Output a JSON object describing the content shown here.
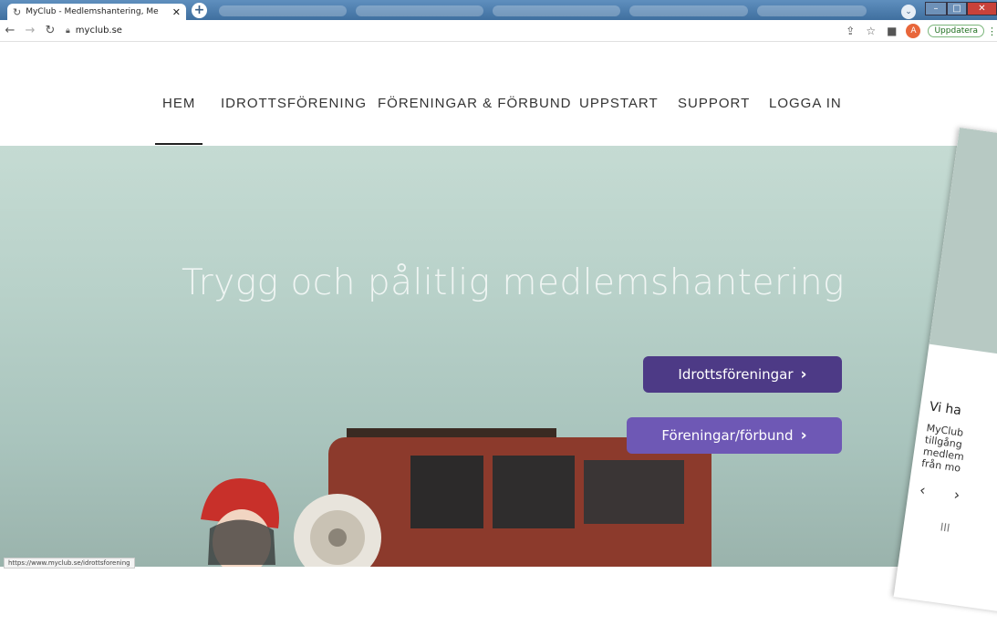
{
  "browser": {
    "tab_title": "MyClub - Medlemshantering, Me",
    "url": "myclub.se",
    "update_label": "Uppdatera",
    "profile_initial": "A",
    "status_url": "https://www.myclub.se/idrottsforening"
  },
  "nav": {
    "items": [
      {
        "label": "HEM"
      },
      {
        "label": "IDROTTSFÖRENING"
      },
      {
        "label": "FÖRENINGAR & FÖRBUND"
      },
      {
        "label": "UPPSTART"
      },
      {
        "label": "SUPPORT"
      },
      {
        "label": "LOGGA IN"
      }
    ]
  },
  "hero": {
    "title": "Trygg och pålitlig medlemshantering",
    "cta_primary": "Idrottsföreningar",
    "cta_secondary": "Föreningar/förbund"
  },
  "overlay": {
    "heading": "Vi ha",
    "text_lines": [
      "MyClub",
      "tillgång",
      "medlem",
      "från mo"
    ],
    "pager": "III"
  },
  "colors": {
    "cta_primary": "#4d3a86",
    "cta_secondary": "#6e58b5",
    "update_green": "#1e6e1e"
  }
}
